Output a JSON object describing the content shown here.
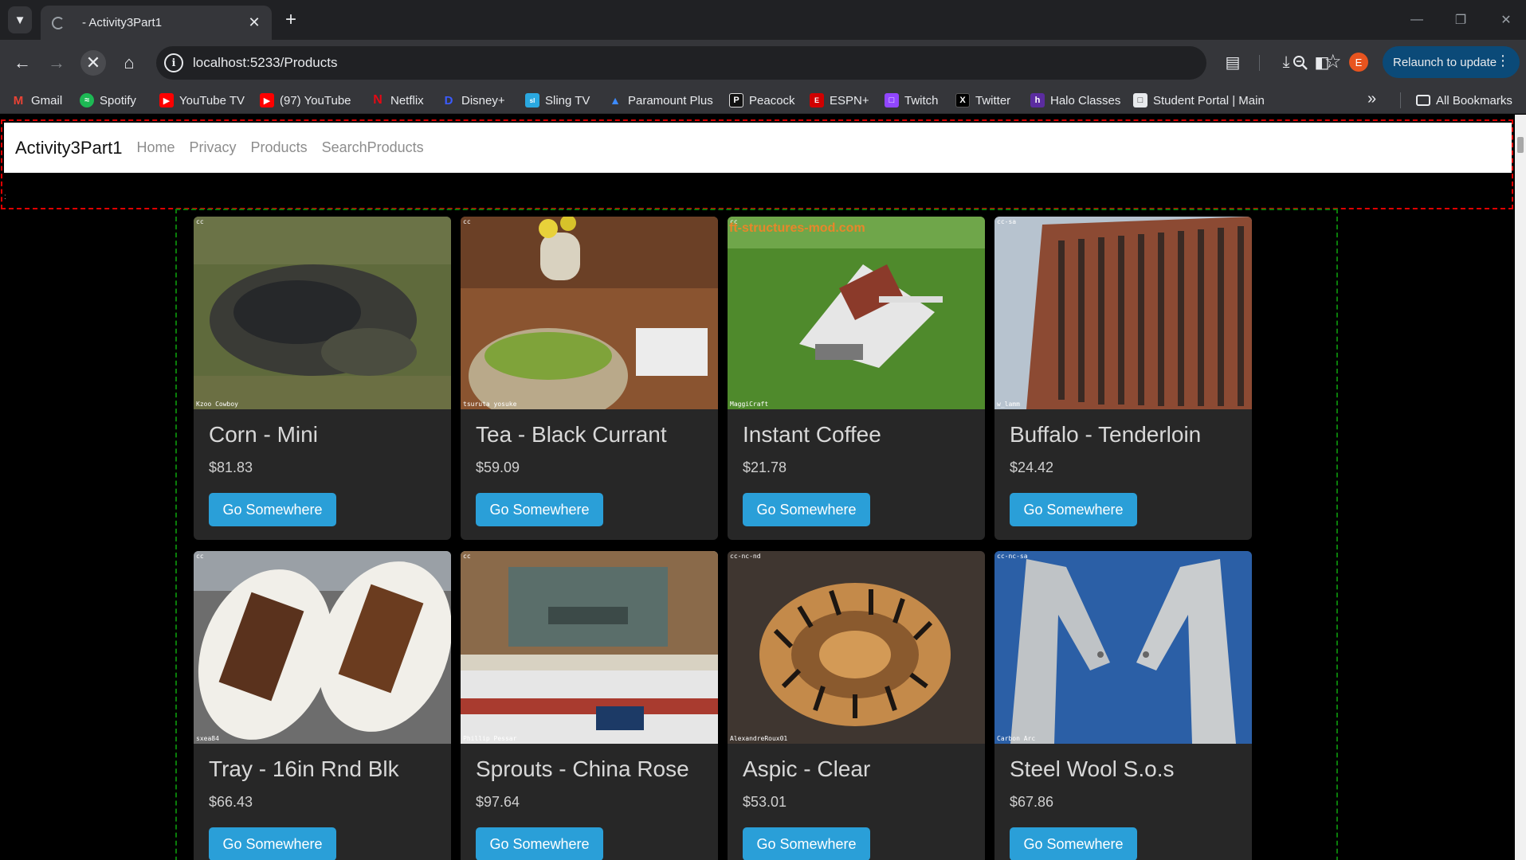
{
  "browser": {
    "tab_title": " - Activity3Part1",
    "url": "localhost:5233/Products",
    "relaunch_label": "Relaunch to update",
    "profile_initial": "E",
    "bookmarks": [
      {
        "label": "Gmail",
        "icon": "gmail-icon",
        "color": "#ea4335"
      },
      {
        "label": "Spotify",
        "icon": "spotify-icon",
        "color": "#1db954"
      },
      {
        "label": "YouTube TV",
        "icon": "youtube-tv-icon",
        "color": "#ff0000"
      },
      {
        "label": "(97) YouTube",
        "icon": "youtube-icon",
        "color": "#ff0000"
      },
      {
        "label": "Netflix",
        "icon": "netflix-icon",
        "color": "#e50914"
      },
      {
        "label": "Disney+",
        "icon": "disney-icon",
        "color": "#113ccf"
      },
      {
        "label": "Sling TV",
        "icon": "sling-icon",
        "color": "#2aa8e0"
      },
      {
        "label": "Paramount Plus",
        "icon": "paramount-icon",
        "color": "#0064ff"
      },
      {
        "label": "Peacock",
        "icon": "peacock-icon",
        "color": "#000000"
      },
      {
        "label": "ESPN+",
        "icon": "espn-icon",
        "color": "#d00000"
      },
      {
        "label": "Twitch",
        "icon": "twitch-icon",
        "color": "#9146ff"
      },
      {
        "label": "Twitter",
        "icon": "twitter-x-icon",
        "color": "#000000"
      },
      {
        "label": "Halo Classes",
        "icon": "halo-icon",
        "color": "#5b2ca0"
      },
      {
        "label": "Student Portal | Main",
        "icon": "student-portal-icon",
        "color": "#e8eaed"
      }
    ],
    "all_bookmarks_label": "All Bookmarks"
  },
  "site": {
    "brand": "Activity3Part1",
    "nav": [
      "Home",
      "Privacy",
      "Products",
      "SearchProducts"
    ]
  },
  "button_label": "Go Somewhere",
  "products": [
    {
      "name": "Corn - Mini",
      "price": "$81.83",
      "license": "cc",
      "credit": "Kzoo Cowboy"
    },
    {
      "name": "Tea - Black Currant",
      "price": "$59.09",
      "license": "cc",
      "credit": "tsuruta yosuke"
    },
    {
      "name": "Instant Coffee",
      "price": "$21.78",
      "license": "cc",
      "credit": "MaggiCraft",
      "watermark": "ft-structures-mod.com"
    },
    {
      "name": "Buffalo - Tenderloin",
      "price": "$24.42",
      "license": "cc-sa",
      "credit": "w_lamm"
    },
    {
      "name": "Tray - 16in Rnd Blk",
      "price": "$66.43",
      "license": "cc",
      "credit": "sxea84"
    },
    {
      "name": "Sprouts - China Rose",
      "price": "$97.64",
      "license": "cc",
      "credit": "Phillip Pessar"
    },
    {
      "name": "Aspic - Clear",
      "price": "$53.01",
      "license": "cc-nc-nd",
      "credit": "AlexandreRoux01"
    },
    {
      "name": "Steel Wool S.o.s",
      "price": "$67.86",
      "license": "cc-nc-sa",
      "credit": "Carbon Arc"
    }
  ],
  "colors": {
    "accent_button": "#2a9fd8",
    "card_bg": "#272727",
    "header_outline": "#e00000",
    "container_outline": "#0a7d0a"
  }
}
